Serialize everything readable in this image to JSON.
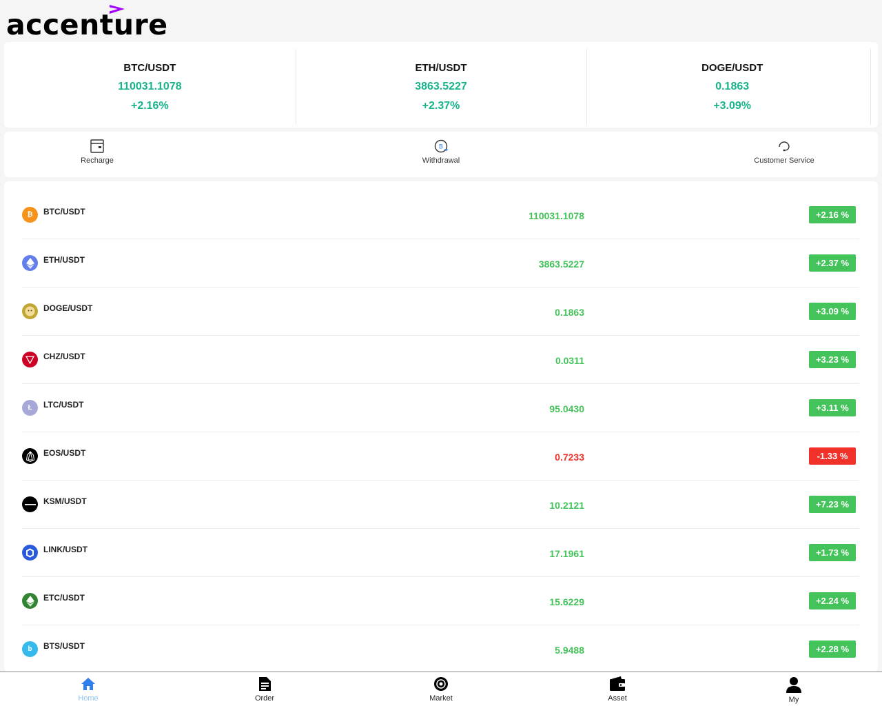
{
  "brand": {
    "logo_text": "accenture",
    "accent_color": "#a100ff"
  },
  "colors": {
    "up": "#44c35a",
    "down": "#f0322a",
    "teal": "#18b38b",
    "nav_active": "#2f80ed"
  },
  "tickers": [
    {
      "pair": "BTC/USDT",
      "price": "110031.1078",
      "change": "+2.16%"
    },
    {
      "pair": "ETH/USDT",
      "price": "3863.5227",
      "change": "+2.37%"
    },
    {
      "pair": "DOGE/USDT",
      "price": "0.1863",
      "change": "+3.09%"
    }
  ],
  "actions": [
    {
      "label": "Recharge",
      "icon": "wallet-icon"
    },
    {
      "label": "Withdrawal",
      "icon": "bitcoin-withdraw-icon"
    },
    {
      "label": "Customer Service",
      "icon": "headset-icon"
    }
  ],
  "markets": [
    {
      "pair": "BTC/USDT",
      "price": "110031.1078",
      "change": "+2.16 %",
      "direction": "up",
      "icon": "btc-coin-icon",
      "icon_color": "#f7931a"
    },
    {
      "pair": "ETH/USDT",
      "price": "3863.5227",
      "change": "+2.37 %",
      "direction": "up",
      "icon": "eth-coin-icon",
      "icon_color": "#627eea"
    },
    {
      "pair": "DOGE/USDT",
      "price": "0.1863",
      "change": "+3.09 %",
      "direction": "up",
      "icon": "doge-coin-icon",
      "icon_color": "#c2a633"
    },
    {
      "pair": "CHZ/USDT",
      "price": "0.0311",
      "change": "+3.23 %",
      "direction": "up",
      "icon": "chz-coin-icon",
      "icon_color": "#cd0124"
    },
    {
      "pair": "LTC/USDT",
      "price": "95.0430",
      "change": "+3.11 %",
      "direction": "up",
      "icon": "ltc-coin-icon",
      "icon_color": "#a6a9d8"
    },
    {
      "pair": "EOS/USDT",
      "price": "0.7233",
      "change": "-1.33 %",
      "direction": "down",
      "icon": "eos-coin-icon",
      "icon_color": "#000000"
    },
    {
      "pair": "KSM/USDT",
      "price": "10.2121",
      "change": "+7.23 %",
      "direction": "up",
      "icon": "ksm-coin-icon",
      "icon_color": "#000000"
    },
    {
      "pair": "LINK/USDT",
      "price": "17.1961",
      "change": "+1.73 %",
      "direction": "up",
      "icon": "link-coin-icon",
      "icon_color": "#2a5ada"
    },
    {
      "pair": "ETC/USDT",
      "price": "15.6229",
      "change": "+2.24 %",
      "direction": "up",
      "icon": "etc-coin-icon",
      "icon_color": "#328332"
    },
    {
      "pair": "BTS/USDT",
      "price": "5.9488",
      "change": "+2.28 %",
      "direction": "up",
      "icon": "bts-coin-icon",
      "icon_color": "#35baeb"
    }
  ],
  "nav": [
    {
      "label": "Home",
      "icon": "home-icon",
      "active": true
    },
    {
      "label": "Order",
      "icon": "document-icon",
      "active": false
    },
    {
      "label": "Market",
      "icon": "market-icon",
      "active": false
    },
    {
      "label": "Asset",
      "icon": "wallet-icon",
      "active": false
    },
    {
      "label": "My",
      "icon": "user-icon",
      "active": false
    }
  ]
}
